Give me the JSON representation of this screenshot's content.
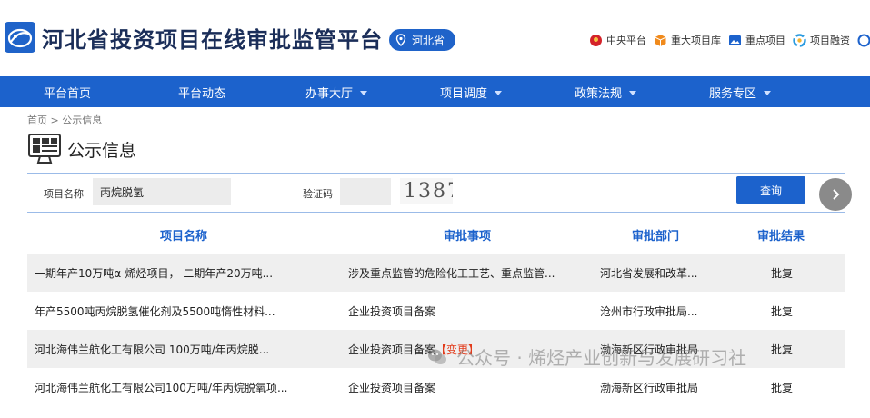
{
  "header": {
    "site_title": "河北省投资项目在线审批监管平台",
    "region": "河北省",
    "links": [
      {
        "label": "中央平台",
        "icon": "emblem-icon",
        "color": "#d4232a"
      },
      {
        "label": "重大项目库",
        "icon": "cube-icon",
        "color": "#f08a1c"
      },
      {
        "label": "重点项目",
        "icon": "picture-icon",
        "color": "#1c62cc"
      },
      {
        "label": "项目融资",
        "icon": "swirl-icon",
        "color": "#2a9be0"
      },
      {
        "label": "",
        "icon": "circle-icon",
        "color": "#1c62cc"
      }
    ]
  },
  "nav": [
    {
      "label": "平台首页",
      "has_dropdown": false
    },
    {
      "label": "平台动态",
      "has_dropdown": false
    },
    {
      "label": "办事大厅",
      "has_dropdown": true
    },
    {
      "label": "项目调度",
      "has_dropdown": true
    },
    {
      "label": "政策法规",
      "has_dropdown": true
    },
    {
      "label": "服务专区",
      "has_dropdown": true
    }
  ],
  "breadcrumb": "首页 > 公示信息",
  "section_title": "公示信息",
  "search": {
    "project_name_label": "项目名称",
    "project_name_value": "丙烷脱氢",
    "captcha_label": "验证码",
    "captcha_value": "",
    "captcha_image_text": "1387",
    "query_button": "查询"
  },
  "table": {
    "headers": [
      "项目名称",
      "审批事项",
      "审批部门",
      "审批结果"
    ],
    "rows": [
      {
        "name": "一期年产10万吨α-烯烃项目， 二期年产20万吨...",
        "matter": "涉及重点监管的危险化工工艺、重点监管...",
        "tag": "",
        "dept": "河北省发展和改革...",
        "result": "批复"
      },
      {
        "name": "年产5500吨丙烷脱氢催化剂及5500吨惰性材料...",
        "matter": "企业投资项目备案",
        "tag": "",
        "dept": "沧州市行政审批局...",
        "result": "批复"
      },
      {
        "name": "河北海伟兰航化工有限公司 100万吨/年丙烷脱...",
        "matter": "企业投资项目备案",
        "tag": "【变更】",
        "dept": "渤海新区行政审批局",
        "result": "批复"
      },
      {
        "name": "河北海伟兰航化工有限公司100万吨/年丙烷脱氧项...",
        "matter": "企业投资项目备案",
        "tag": "",
        "dept": "渤海新区行政审批局",
        "result": "批复"
      }
    ]
  },
  "watermark": "公众号 · 烯烃产业创新与发展研习社",
  "colors": {
    "primary": "#1c62cc",
    "title": "#1b2e59",
    "accent_red": "#e23b1b",
    "row_alt": "#efefef"
  }
}
